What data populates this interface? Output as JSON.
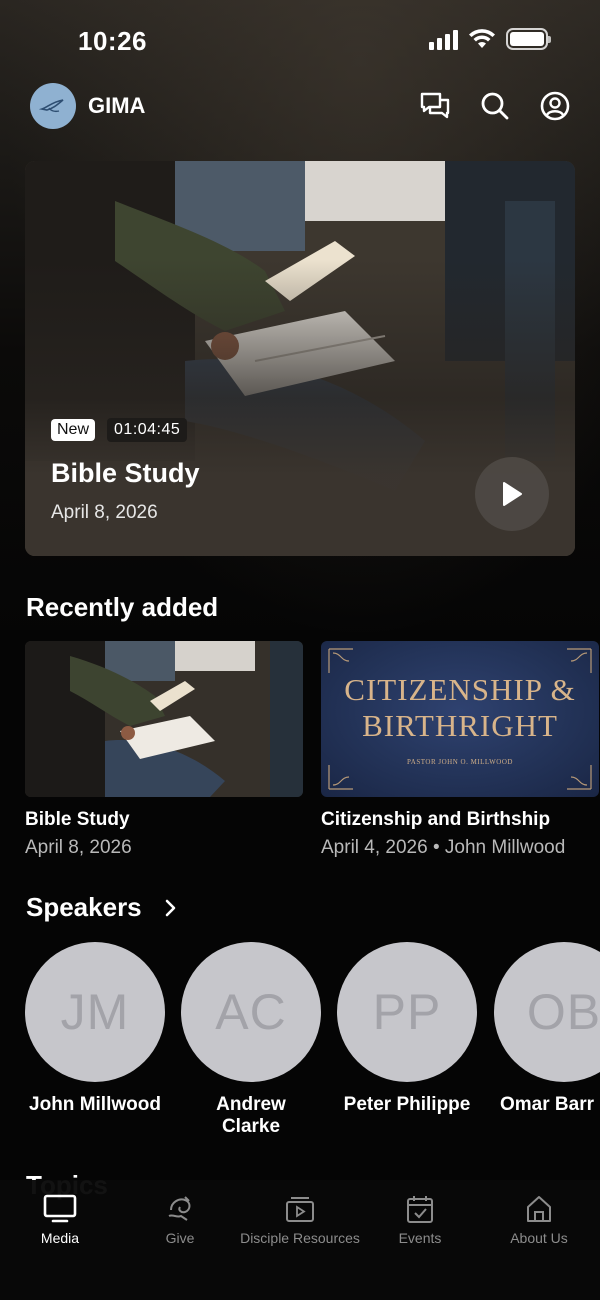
{
  "status_bar": {
    "time": "10:26"
  },
  "header": {
    "brand": "GIMA"
  },
  "hero": {
    "badge": "New",
    "duration": "01:04:45",
    "title": "Bible Study",
    "date": "April 8, 2026"
  },
  "recently_added": {
    "title": "Recently added",
    "items": [
      {
        "title": "Bible Study",
        "subtitle": "April 8, 2026"
      },
      {
        "title": "Citizenship and Birthship",
        "subtitle": "April 4, 2026 • John Millwood",
        "thumb_line1": "CITIZENSHIP &",
        "thumb_line2": "BIRTHRIGHT",
        "thumb_pastor": "PASTOR JOHN O. MILLWOOD"
      }
    ]
  },
  "speakers": {
    "title": "Speakers",
    "items": [
      {
        "initials": "JM",
        "name": "John Millwood"
      },
      {
        "initials": "AC",
        "name": "Andrew Clarke"
      },
      {
        "initials": "PP",
        "name": "Peter Philippe"
      },
      {
        "initials": "OB",
        "name": "Omar Barr"
      }
    ]
  },
  "topics": {
    "title": "Topics"
  },
  "tabbar": {
    "items": [
      {
        "label": "Media",
        "icon": "tv-icon",
        "active": true
      },
      {
        "label": "Give",
        "icon": "give-icon",
        "active": false
      },
      {
        "label": "Disciple Resources",
        "icon": "play-square-icon",
        "active": false
      },
      {
        "label": "Events",
        "icon": "calendar-icon",
        "active": false
      },
      {
        "label": "About Us",
        "icon": "home-icon",
        "active": false
      }
    ]
  },
  "colors": {
    "background": "#050505",
    "avatar_bg": "#c6c6cb",
    "avatar_text": "#a3a3a9",
    "thumb_gold": "#d8b48a",
    "thumb_navy": "#233358",
    "logo_blue": "#8fb1d1"
  }
}
